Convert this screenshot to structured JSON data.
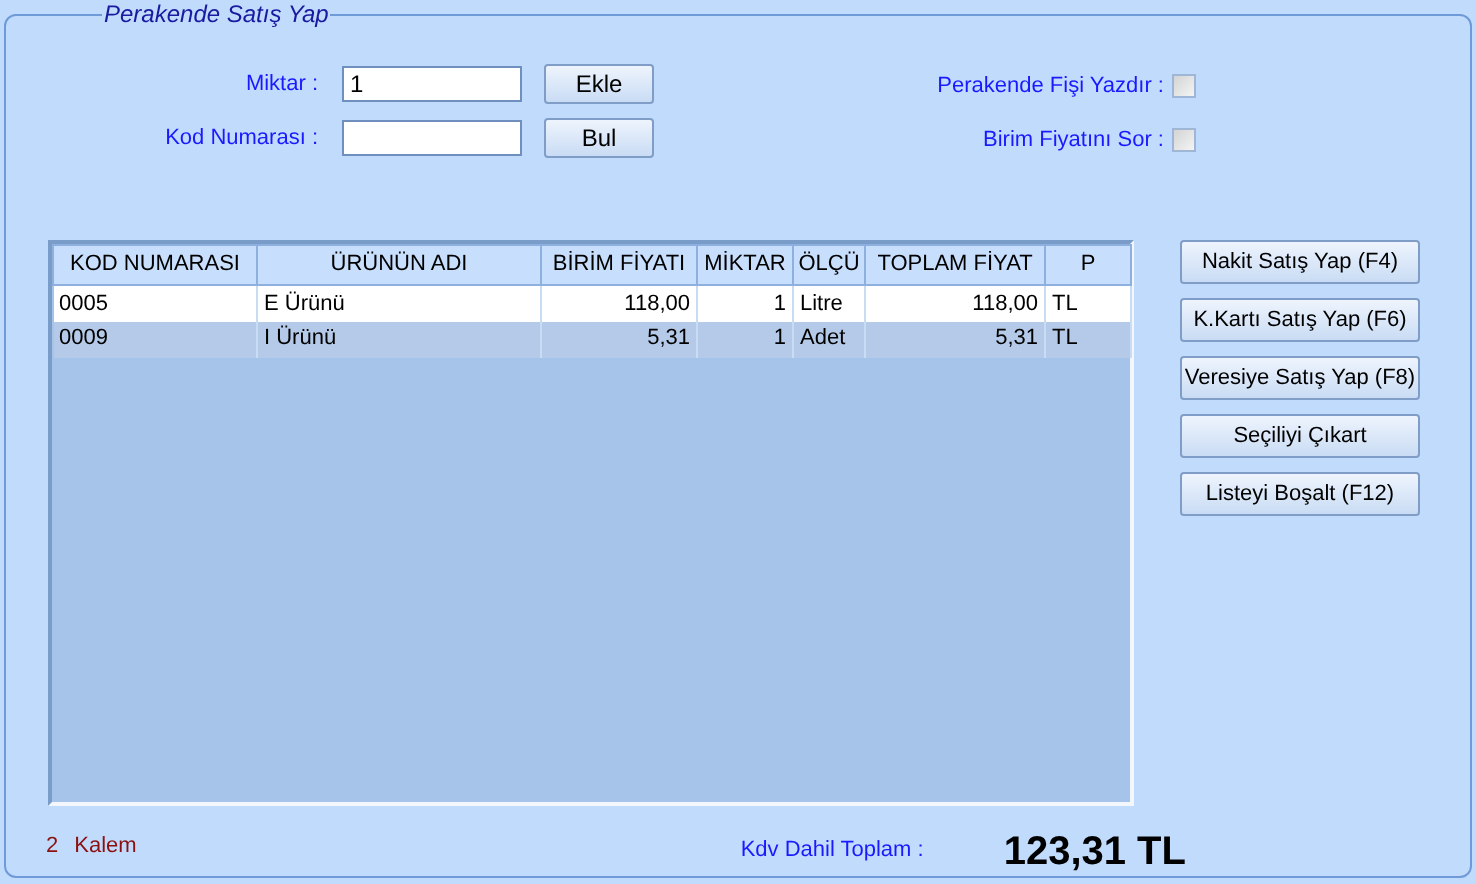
{
  "group_title": "Perakende Satış Yap",
  "fields": [
    {
      "label": "Miktar  :",
      "value": "1",
      "button": "Ekle"
    },
    {
      "label": "Kod Numarası  :",
      "button": "Bul"
    }
  ],
  "options": [
    {
      "label": "Perakende Fişi Yazdır :",
      "checked": false
    },
    {
      "label": "Birim Fiyatını Sor :",
      "checked": false
    }
  ],
  "table": {
    "columns": [
      "KOD NUMARASI",
      "ÜRÜNÜN ADI",
      "BİRİM FİYATI",
      "MİKTAR",
      "ÖLÇÜ",
      "TOPLAM FİYAT",
      "P"
    ],
    "rows": [
      {
        "selected": false,
        "cells": [
          "0005",
          "E Ürünü",
          "118,00",
          "1",
          "Litre",
          "118,00",
          "TL"
        ]
      },
      {
        "selected": true,
        "cells": [
          "0009",
          "I Ürünü",
          "5,31",
          "1",
          "Adet",
          "5,31",
          "TL"
        ]
      }
    ]
  },
  "actions": [
    "Nakit Satış Yap (F4)",
    "K.Kartı Satış Yap (F6)",
    "Veresiye Satış Yap (F8)",
    "Seçiliyi Çıkart",
    "Listeyi Boşalt (F12)"
  ],
  "item_count": "2",
  "item_label": "Kalem",
  "total_label": "Kdv Dahil Toplam  :",
  "total": "123,31 TL"
}
